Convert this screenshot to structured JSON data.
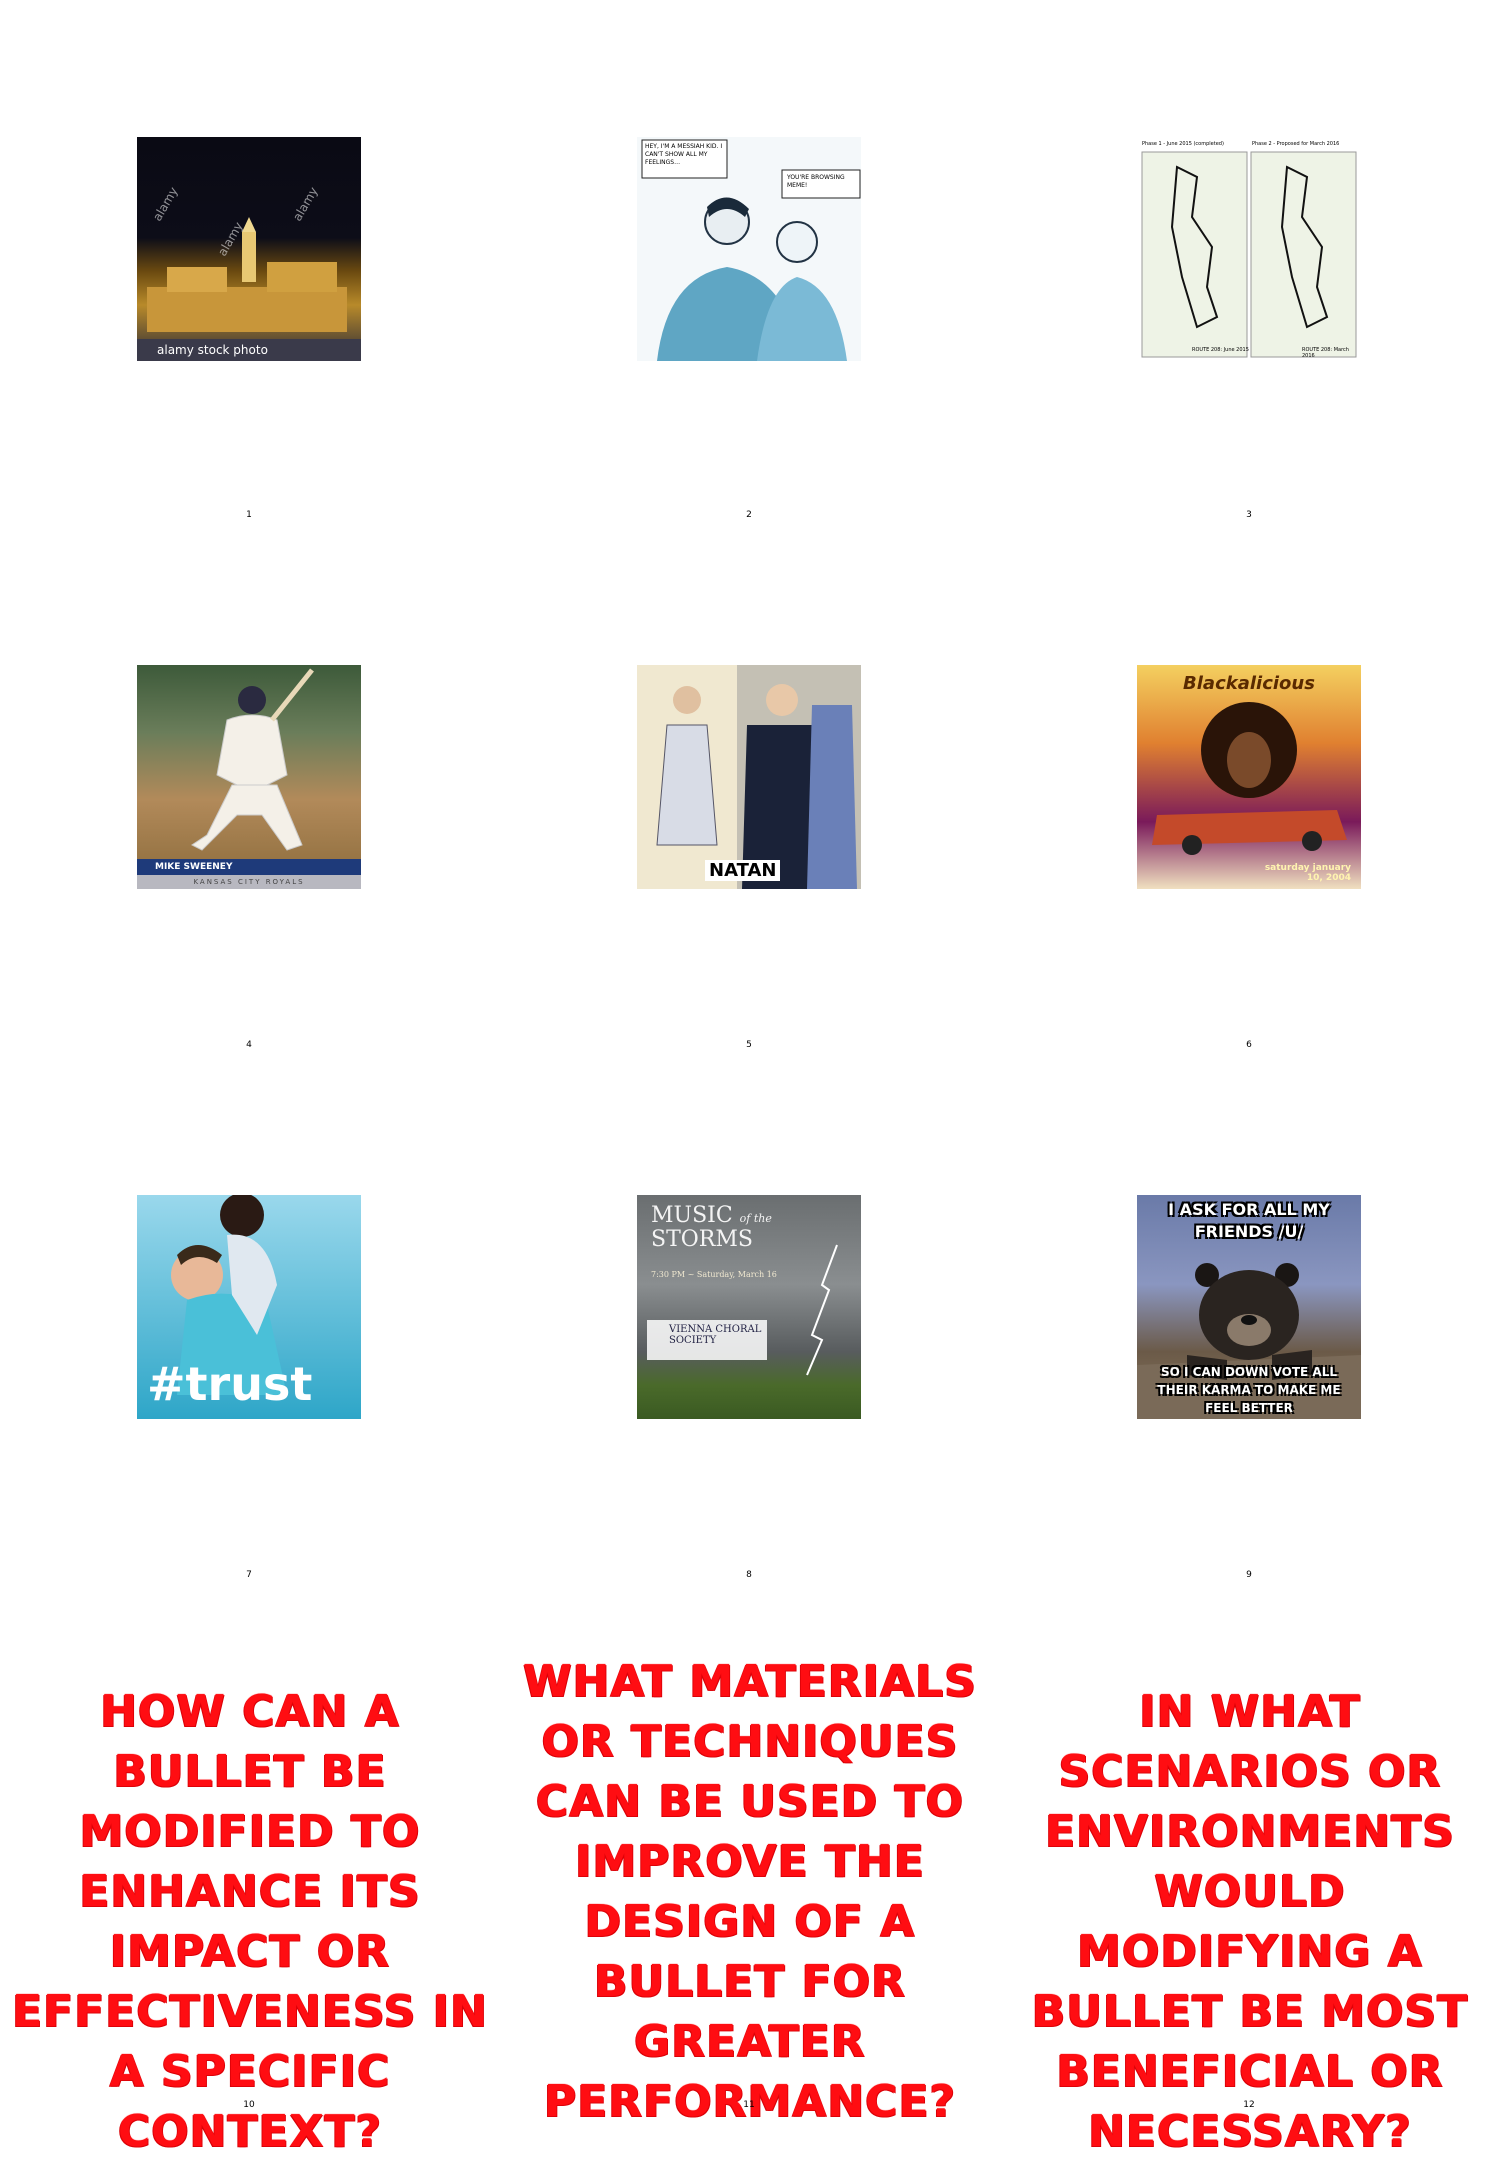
{
  "cells": [
    {
      "number": "1"
    },
    {
      "number": "2"
    },
    {
      "number": "3"
    },
    {
      "number": "4"
    },
    {
      "number": "5"
    },
    {
      "number": "6"
    },
    {
      "number": "7"
    },
    {
      "number": "8"
    },
    {
      "number": "9"
    },
    {
      "number": "10"
    },
    {
      "number": "11"
    },
    {
      "number": "12"
    }
  ],
  "images": {
    "img1": {
      "watermark": "alamy",
      "caption": "alamy stock photo",
      "icon": "photo-icon"
    },
    "img2": {
      "bubble1": "HEY, I'M A MESSIAH KID. I CAN'T SHOW ALL MY FEELINGS…",
      "bubble2": "YOU'RE BROWSING MEME!"
    },
    "img3": {
      "label_left": "Phase 1 - June 2015 (completed)",
      "label_right": "Phase 2 - Proposed for March 2016",
      "route_left": "ROUTE 208: June 2015",
      "route_right": "ROUTE 208: March 2016"
    },
    "img4": {
      "player": "MIKE SWEENEY",
      "team": "KANSAS CITY ROYALS"
    },
    "img5": {
      "brand": "NATAN"
    },
    "img6": {
      "title": "Blackalicious",
      "date": "saturday january 10, 2004"
    },
    "img7": {
      "hashtag": "#trust"
    },
    "img8": {
      "title_1": "MUSIC",
      "title_2": "of the",
      "title_3": "STORMS",
      "time": "7:30 PM ~ Saturday, March 16",
      "org": "VIENNA CHORAL SOCIETY"
    },
    "img9": {
      "top_text": "I ASK FOR ALL MY FRIENDS /U/",
      "bottom_text": "SO I CAN DOWN VOTE ALL THEIR KARMA TO MAKE ME FEEL BETTER"
    }
  },
  "questions": {
    "q10": "HOW CAN A BULLET BE MODIFIED TO ENHANCE ITS IMPACT OR EFFECTIVENESS IN A SPECIFIC CONTEXT?",
    "q11": "WHAT MATERIALS OR TECHNIQUES CAN BE USED TO IMPROVE THE DESIGN OF A BULLET FOR GREATER PERFORMANCE?",
    "q12": "IN WHAT SCENARIOS OR ENVIRONMENTS WOULD MODIFYING A BULLET BE MOST BENEFICIAL OR NECESSARY?"
  },
  "colors": {
    "question_text": "#ff0d12",
    "background": "#ffffff"
  }
}
